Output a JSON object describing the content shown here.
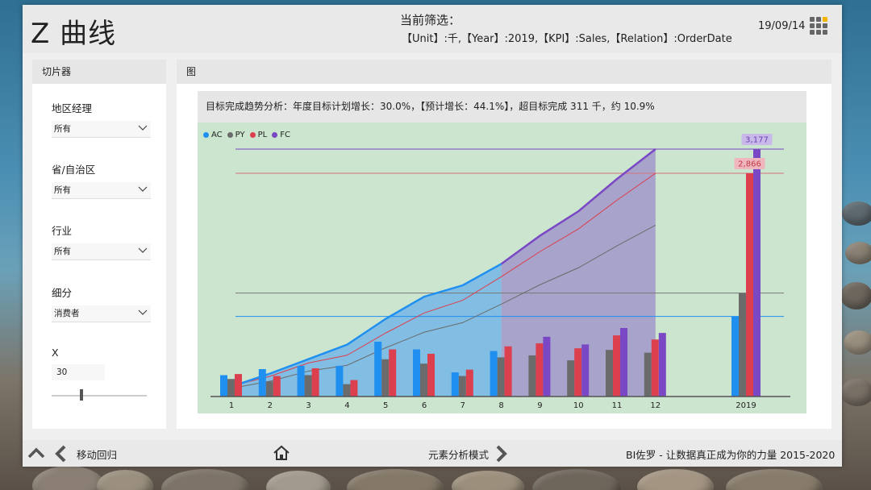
{
  "header": {
    "title": "Z 曲线",
    "filter_heading": "当前筛选：",
    "filter_text": "【Unit】:千,【Year】:2019,【KPI】:Sales,【Relation】:OrderDate",
    "date": "19/09/14"
  },
  "slicer_panel": {
    "title": "切片器",
    "slicers": [
      {
        "label": "地区经理",
        "value": "所有"
      },
      {
        "label": "省/自治区",
        "value": "所有"
      },
      {
        "label": "行业",
        "value": "所有"
      },
      {
        "label": "细分",
        "value": "消费者"
      }
    ],
    "x_label": "X",
    "x_value": "30",
    "x_slider_fraction": 0.3
  },
  "chart_panel": {
    "title": "图",
    "subtitle": "目标完成趋势分析：年度目标计划增长：30.0%，【预计增长：44.1%】，超目标完成 311 千，约 10.9%"
  },
  "chart_data": {
    "type": "bar",
    "legend": [
      "AC",
      "PY",
      "PL",
      "FC"
    ],
    "colors": {
      "AC": "#1f8ff0",
      "PY": "#6b6b6b",
      "PL": "#dc3f4d",
      "FC": "#7a48c4"
    },
    "categories": [
      "1",
      "2",
      "3",
      "4",
      "5",
      "6",
      "7",
      "8",
      "9",
      "10",
      "11",
      "12"
    ],
    "monthly": {
      "AC": [
        78,
        100,
        112,
        112,
        200,
        172,
        88,
        166,
        null,
        null,
        null,
        null
      ],
      "PY": [
        64,
        55,
        78,
        45,
        136,
        120,
        75,
        143,
        150,
        132,
        170,
        160
      ],
      "PL": [
        82,
        75,
        103,
        60,
        172,
        156,
        98,
        183,
        194,
        176,
        223,
        208
      ],
      "FC": [
        null,
        null,
        null,
        null,
        null,
        null,
        null,
        null,
        218,
        190,
        250,
        232
      ]
    },
    "cumulative": {
      "AC": [
        78,
        178,
        290,
        402,
        602,
        774,
        862,
        1028,
        null,
        null,
        null,
        null
      ],
      "PY": [
        64,
        119,
        197,
        242,
        378,
        498,
        573,
        716,
        866,
        998,
        1168,
        1328
      ],
      "PL": [
        82,
        157,
        260,
        320,
        492,
        648,
        746,
        929,
        1123,
        1299,
        1522,
        1730
      ],
      "FC": [
        null,
        null,
        null,
        null,
        null,
        null,
        null,
        1028,
        1246,
        1436,
        1686,
        1918
      ]
    },
    "totals": {
      "category": "2019",
      "AC": 1028,
      "PY": 1328,
      "PL": 2866,
      "FC": 3177
    },
    "total_labels": {
      "PL": "2,866",
      "FC": "3,177"
    },
    "line_max": 1918,
    "total_max": 3177,
    "forecast_start_month": "8"
  }
}
